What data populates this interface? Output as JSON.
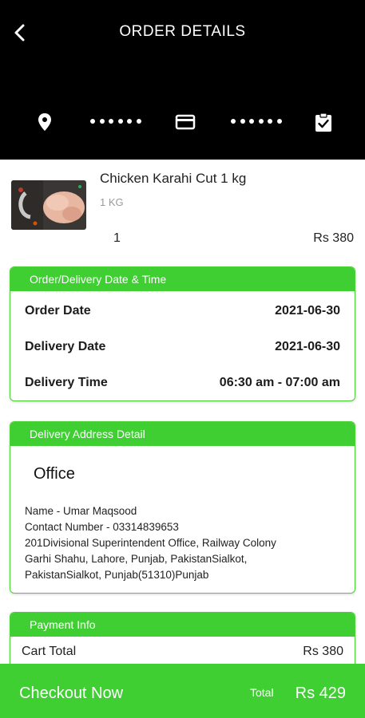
{
  "header": {
    "title": "ORDER DETAILS",
    "back_icon": "arrow-back-icon"
  },
  "steps": {
    "icons": [
      "location-pin-icon",
      "credit-card-icon",
      "clipboard-check-icon"
    ],
    "state": "all steps shown in white"
  },
  "item": {
    "name": "Chicken Karahi Cut 1 kg",
    "unit": "1 KG",
    "quantity": "1",
    "price": "Rs 380"
  },
  "datetime_card": {
    "heading": "Order/Delivery Date & Time",
    "rows": [
      {
        "label": "Order Date",
        "value": "2021-06-30"
      },
      {
        "label": "Delivery Date",
        "value": "2021-06-30"
      },
      {
        "label": "Delivery Time",
        "value": "06:30 am - 07:00 am"
      }
    ]
  },
  "address_card": {
    "heading": "Delivery Address Detail",
    "type": "Office",
    "lines": [
      "Name - Umar Maqsood",
      "Contact Number - 03314839653",
      "201Divisional Superintendent Office, Railway Colony",
      "Garhi Shahu, Lahore, Punjab, PakistanSialkot,",
      "PakistanSialkot, Punjab(51310)Punjab"
    ]
  },
  "payment_card": {
    "heading": "Payment Info",
    "cart_total_label": "Cart Total",
    "cart_total_value": "Rs 380"
  },
  "checkout": {
    "label": "Checkout Now",
    "total_label": "Total",
    "total_value": "Rs 429"
  },
  "colors": {
    "accent": "#3fcf32",
    "header_bg": "#000000",
    "text": "#1a1a1a"
  }
}
